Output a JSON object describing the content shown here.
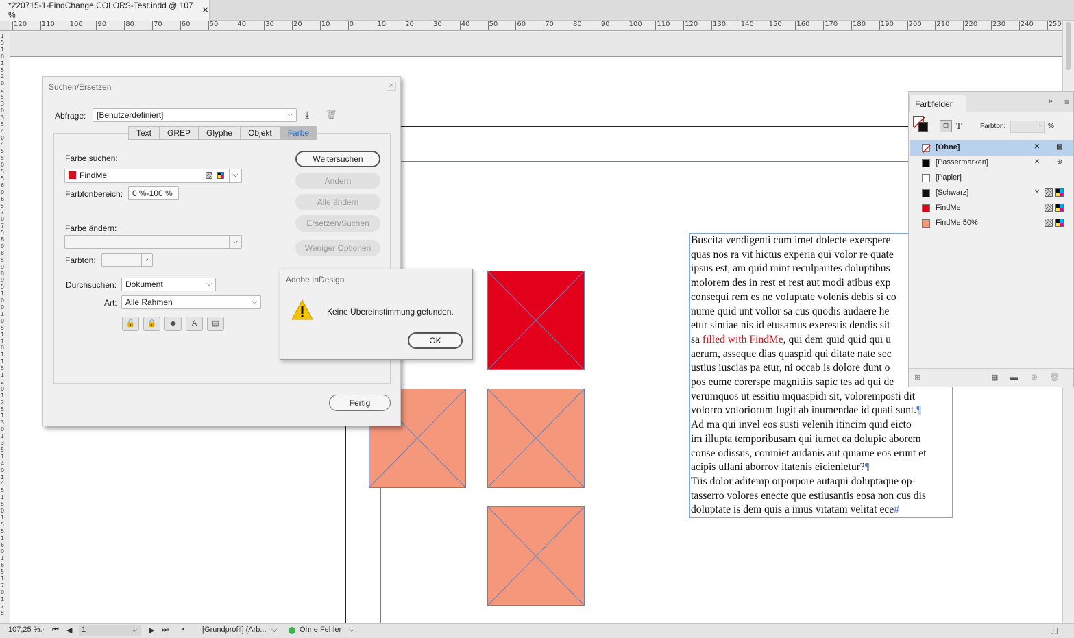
{
  "document_tab": {
    "title": "*220715-1-FindChange COLORS-Test.indd @ 107 %",
    "close": "✕"
  },
  "ruler": {
    "h_labels": [
      "120",
      "110",
      "100",
      "90",
      "80",
      "70",
      "60",
      "50",
      "40",
      "30",
      "20",
      "10",
      "0",
      "10",
      "20",
      "30",
      "40",
      "50",
      "60",
      "70",
      "80",
      "90",
      "100",
      "110",
      "120",
      "130",
      "140",
      "150",
      "160",
      "170",
      "180",
      "190",
      "200",
      "210",
      "220",
      "230",
      "240",
      "250"
    ],
    "v_labels": [
      "1",
      "5",
      "1",
      "0",
      "1",
      "5",
      "2",
      "0",
      "2",
      "5",
      "3",
      "0",
      "3",
      "5",
      "4",
      "0",
      "4",
      "5",
      "5",
      "0",
      "5",
      "5",
      "6",
      "0",
      "6",
      "5",
      "7",
      "0",
      "7",
      "5",
      "8",
      "0",
      "8",
      "5",
      "9",
      "0",
      "9",
      "5",
      "1",
      "0",
      "0",
      "1",
      "0",
      "5",
      "1",
      "1",
      "0",
      "1",
      "1",
      "5",
      "1",
      "2",
      "0",
      "1",
      "2",
      "5",
      "1",
      "3",
      "0",
      "1",
      "3",
      "5",
      "1",
      "4",
      "0",
      "1",
      "4",
      "5",
      "1",
      "5",
      "0",
      "1",
      "5",
      "5",
      "1",
      "6",
      "0",
      "1",
      "6",
      "5",
      "1",
      "7",
      "0",
      "1",
      "7",
      "5"
    ]
  },
  "find_dialog": {
    "title": "Suchen/Ersetzen",
    "query_label": "Abfrage:",
    "query_value": "[Benutzerdefiniert]",
    "tabs": [
      {
        "label": "Text",
        "active": false
      },
      {
        "label": "GREP",
        "active": false
      },
      {
        "label": "Glyphe",
        "active": false
      },
      {
        "label": "Objekt",
        "active": false
      },
      {
        "label": "Farbe",
        "active": true
      }
    ],
    "find_color_label": "Farbe suchen:",
    "find_color_value": "FindMe",
    "find_color_hex": "#d0101a",
    "tint_range_label": "Farbtonbereich:",
    "tint_range_value": "0 %-100 %",
    "change_color_label": "Farbe ändern:",
    "change_color_value": "",
    "tint_label": "Farbton:",
    "tint_value": "",
    "search_label": "Durchsuchen:",
    "search_value": "Dokument",
    "type_label": "Art:",
    "type_value": "Alle Rahmen",
    "buttons": {
      "find_next": "Weitersuchen",
      "change": "Ändern",
      "change_all": "Alle ändern",
      "change_find": "Ersetzen/Suchen",
      "fewer_options": "Weniger Optionen",
      "done": "Fertig"
    },
    "option_icons": [
      "locked-layers-icon",
      "locked-stories-icon",
      "hidden-layers-icon",
      "master-pages-icon",
      "footnotes-icon"
    ]
  },
  "alert": {
    "title": "Adobe InDesign",
    "message": "Keine Übereinstimmung gefunden.",
    "ok": "OK",
    "icon": "warning-icon"
  },
  "swatches_panel": {
    "title": "Farbfelder",
    "tint_label": "Farbton:",
    "tint_value": "",
    "percent": "%",
    "swatches": [
      {
        "name": "[Ohne]",
        "color": "none",
        "selected": true
      },
      {
        "name": "[Passermarken]",
        "color": "#000000",
        "selected": false
      },
      {
        "name": "[Papier]",
        "color": "#ffffff",
        "selected": false
      },
      {
        "name": "[Schwarz]",
        "color": "#111111",
        "selected": false
      },
      {
        "name": "FindMe",
        "color": "#e2001a",
        "selected": false
      },
      {
        "name": "FindMe 50%",
        "color": "#f4977b",
        "selected": false
      }
    ]
  },
  "frames": {
    "red_fill": "#e2001a",
    "salmon_fill": "#f4977b"
  },
  "story": {
    "lines": [
      "Buscita vendigenti cum imet dolecte exerspere",
      "quas nos ra vit hictus experia qui volor re quate",
      "ipsus est, am quid mint reculparites doluptibus",
      "molorem des in rest et rest aut modi atibus exp",
      "consequi rem es ne voluptate volenis debis si co",
      "nume quid unt vollor sa cus quodis audaere he",
      "etur sintiae nis id etusamus exerestis dendis sit"
    ],
    "line8_prefix": "sa ",
    "highlight": "filled with FindMe",
    "line8_suffix": ", qui dem quid quid qui u",
    "lines2": [
      "aerum, asseque dias quaspid qui ditate nate sec",
      "ustius iuscias pa etur, ni occab is dolore dunt o",
      "pos eume corerspe magnitiis sapic tes ad qui de",
      "verumquos ut essitiu mquaspidi sit, voloremposti dit",
      "volorro voloriorum fugit ab inumendae id quati sunt."
    ],
    "para2": [
      "Ad ma qui invel eos susti velenih itincim quid eicto",
      "im illupta temporibusam qui iumet ea dolupic aborem",
      "conse odissus, comniet audanis aut quiame eos erunt et",
      "acipis ullani aborrov itatenis eicienietur?"
    ],
    "para3": [
      "Tiis dolor aditemp orporpore autaqui doluptaque op-",
      "tasserro volores enecte que estiusantis eosa non cus dis",
      "doluptate is dem quis a imus vitatam velitat ece"
    ],
    "pilcrow": "¶",
    "end_mark": "#"
  },
  "status_bar": {
    "zoom": "107,25 %",
    "page": "1",
    "profile": "[Grundprofil] (Arb...",
    "preflight": "Ohne Fehler",
    "preflight_color": "#3cb44b"
  }
}
